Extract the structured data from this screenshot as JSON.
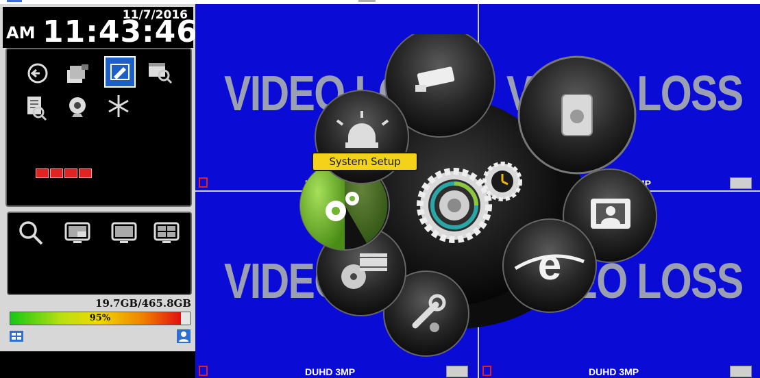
{
  "clock": {
    "date": "11/7/2016",
    "ampm": "AM",
    "time": "11:43:46"
  },
  "toolbar": {
    "icons": [
      "playback-icon",
      "backup-icon",
      "edit-settings-icon",
      "schedule-search-icon",
      "log-search-icon",
      "webcam-icon",
      "freeze-icon"
    ],
    "selected": "edit-settings-icon"
  },
  "hdd_status": {
    "count": 4,
    "color": "#e02424"
  },
  "view": {
    "icons": [
      "zoom-icon",
      "pip-icon",
      "single-view-icon",
      "quad-view-icon"
    ]
  },
  "storage": {
    "used_total": "19.7GB/465.8GB",
    "percent_label": "95%",
    "percent": 0.95
  },
  "cameras": [
    {
      "watermark": "VIDEO LOSS",
      "label": "DU",
      "rec_color": "#e02020"
    },
    {
      "watermark": "VIDEO LOSS",
      "label": "MP"
    },
    {
      "watermark": "VIDEO LOSS",
      "label": "DUHD 3MP",
      "rec_color": "#e02020"
    },
    {
      "watermark": "VIDEO LOSS",
      "label": "DUHD 3MP",
      "rec_color": "#e02020"
    }
  ],
  "menu": {
    "tooltip": "System Setup",
    "items": [
      "camera-setup-icon",
      "hdd-storage-icon",
      "display-setup-icon",
      "network-icon",
      "tools-icon",
      "record-setup-icon",
      "system-setup-icon",
      "event-alarm-icon"
    ],
    "center": "main-setup-gear-icon",
    "active_color": "#6fb52e"
  },
  "colors": {
    "video_bg": "#0b0bd6",
    "panel_bg": "#d7d7d7",
    "tooltip_bg": "#f3d31a"
  }
}
